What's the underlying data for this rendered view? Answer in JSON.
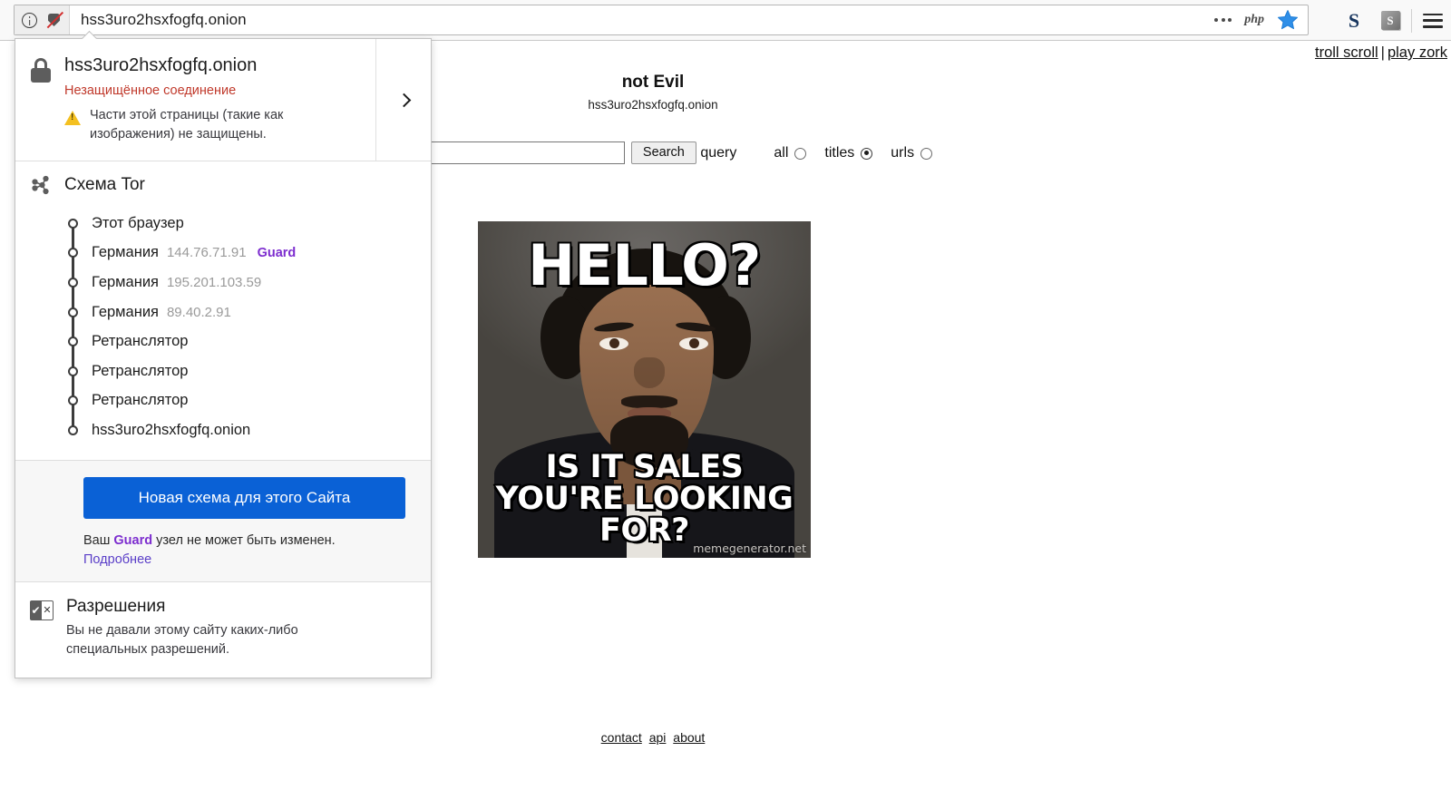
{
  "browser": {
    "url": "hss3uro2hsxfogfq.onion",
    "identity_icon": "info-circle-icon",
    "shield_icon": "shield-broken-icon",
    "overflow_icon": "three-dots-icon",
    "php_badge": "php",
    "bookmark_icon": "star-icon",
    "extension_s_letter": "S",
    "extension_s_box": "S",
    "menu_icon": "hamburger-icon"
  },
  "identity_panel": {
    "site_host": "hss3uro2hsxfogfq.onion",
    "connection_status": "Незащищённое соединение",
    "mixed_content_warning": "Части этой страницы (такие как изображения) не защищены.",
    "expand_icon": "chevron-right-icon",
    "lock_icon": "lock-icon",
    "warning_icon": "warning-triangle-icon",
    "tor": {
      "title": "Схема Tor",
      "icon": "share-circuit-icon",
      "nodes": [
        {
          "label": "Этот браузер",
          "ip": "",
          "tag": ""
        },
        {
          "label": "Германия",
          "ip": "144.76.71.91",
          "tag": "Guard"
        },
        {
          "label": "Германия",
          "ip": "195.201.103.59",
          "tag": ""
        },
        {
          "label": "Германия",
          "ip": "89.40.2.91",
          "tag": ""
        },
        {
          "label": "Ретранслятор",
          "ip": "",
          "tag": ""
        },
        {
          "label": "Ретранслятор",
          "ip": "",
          "tag": ""
        },
        {
          "label": "Ретранслятор",
          "ip": "",
          "tag": ""
        },
        {
          "label": "hss3uro2hsxfogfq.onion",
          "ip": "",
          "tag": ""
        }
      ]
    },
    "new_circuit_button": "Новая схема для этого Сайта",
    "guard_note_prefix": "Ваш ",
    "guard_note_bold": "Guard",
    "guard_note_suffix": " узел не может быть изменен.",
    "learn_more": "Подробнее",
    "permissions": {
      "title": "Разрешения",
      "description": "Вы не давали этому сайту каких-либо специальных разрешений.",
      "icon": "permissions-checkbox-icon"
    }
  },
  "page": {
    "top_links": [
      {
        "label": "troll scroll"
      },
      {
        "label": "play zork"
      }
    ],
    "top_links_separator": "|",
    "site_title": "not Evil",
    "site_onion": "hss3uro2hsxfogfq.onion",
    "search": {
      "value": "",
      "placeholder": "",
      "button_label": "Search",
      "query_label": "query",
      "options": [
        {
          "label": "all",
          "checked": false
        },
        {
          "label": "titles",
          "checked": true
        },
        {
          "label": "urls",
          "checked": false
        }
      ]
    },
    "meme": {
      "top_text": "HELLO?",
      "bottom_text": "IS IT SALES YOU'RE LOOKING FOR?",
      "credit": "memegenerator.net",
      "alt": "lionel-richie-hello-meme"
    },
    "footer_links": [
      {
        "label": "contact"
      },
      {
        "label": "api"
      },
      {
        "label": "about"
      }
    ]
  },
  "colors": {
    "accent_blue": "#0a61d6",
    "error_red": "#c0392b",
    "guard_purple": "#7d2ecf",
    "link_purple": "#5a3ec8",
    "warning_yellow": "#f4c020"
  }
}
